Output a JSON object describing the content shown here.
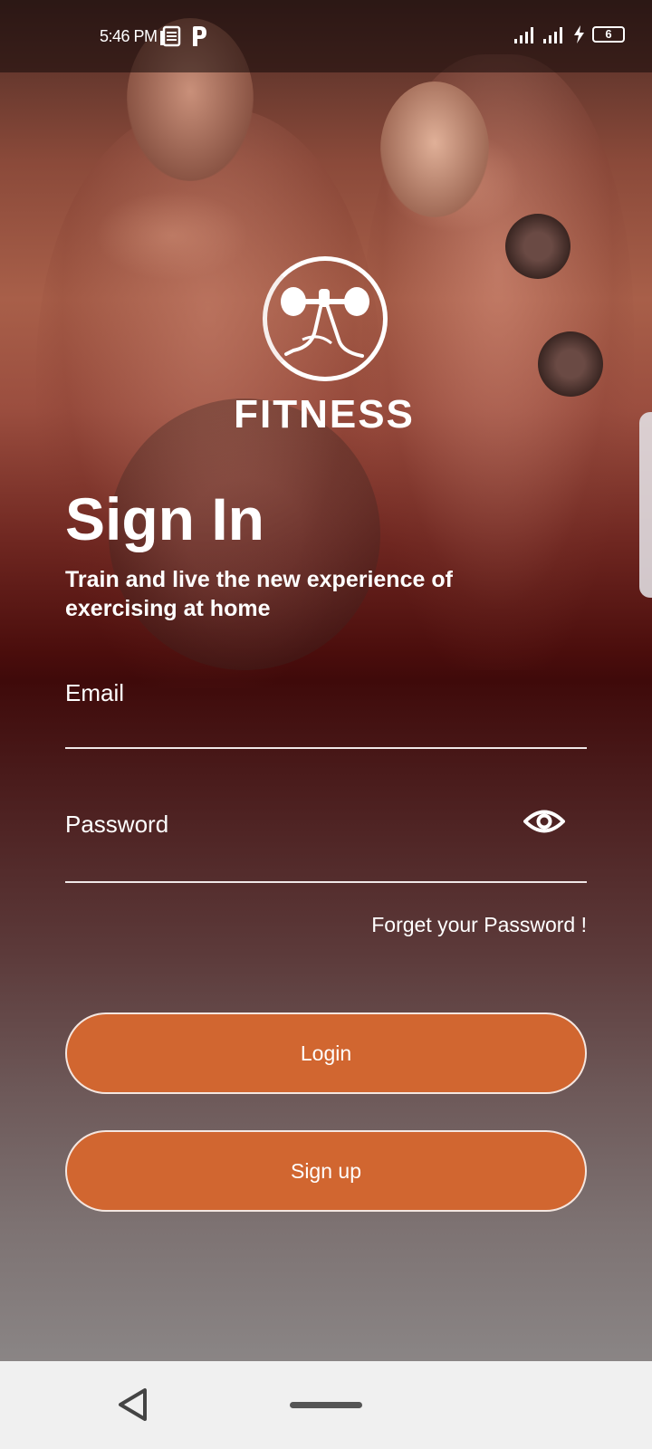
{
  "status_bar": {
    "time": "5:46 PM",
    "battery": "6",
    "icons": [
      "news-icon",
      "p-icon",
      "signal-icon",
      "signal-icon",
      "charging-icon",
      "battery-icon"
    ]
  },
  "logo": {
    "text": "FITNESS",
    "icon": "weightlifter-icon"
  },
  "header": {
    "title": "Sign In",
    "subtitle": "Train and live the new experience of exercising at home"
  },
  "form": {
    "email_placeholder": "Email",
    "email_value": "",
    "password_placeholder": "Password",
    "password_value": "",
    "password_toggle_icon": "eye-icon",
    "forgot_label": "Forget your Password !"
  },
  "buttons": {
    "login_label": "Login",
    "signup_label": "Sign up"
  },
  "colors": {
    "button": "#d16630",
    "text": "#ffffff",
    "nav_bar": "#f0f0f0"
  },
  "nav_bar": {
    "icons": [
      "back-icon",
      "home-pill-icon"
    ]
  }
}
